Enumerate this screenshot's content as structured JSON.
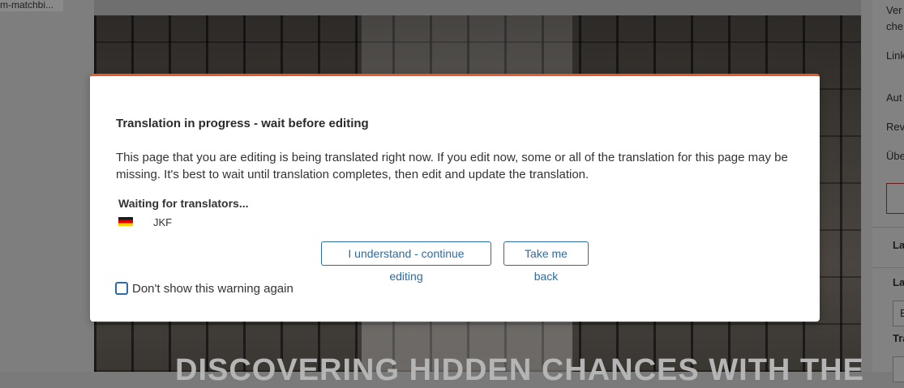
{
  "background": {
    "left_tab_label": "m-matchbi...",
    "hero_title": "DISCOVERING HIDDEN CHANCES WITH THE",
    "right_panel": {
      "labels": [
        "Ver",
        "che",
        "Link",
        "Aut",
        "Rev",
        "Übe"
      ],
      "section_1": "La",
      "section_2": "La",
      "section_3": "Tra",
      "select_1_value": "E"
    }
  },
  "modal": {
    "title": "Translation in progress - wait before editing",
    "body": "This page that you are editing is being translated right now. If you edit now, some or all of the translation for this page may be missing. It's best to wait until translation completes, then edit and update the translation.",
    "waiting_label": "Waiting for translators...",
    "translators": [
      {
        "flag_icon": "german-flag-icon",
        "code": "JKF"
      }
    ],
    "continue_button": "I understand - continue editing",
    "back_button": "Take me back",
    "dont_show_label": "Don't show this warning again",
    "dont_show_checked": false
  },
  "colors": {
    "accent": "#e35a2b",
    "link_blue": "#2a6ca6"
  }
}
